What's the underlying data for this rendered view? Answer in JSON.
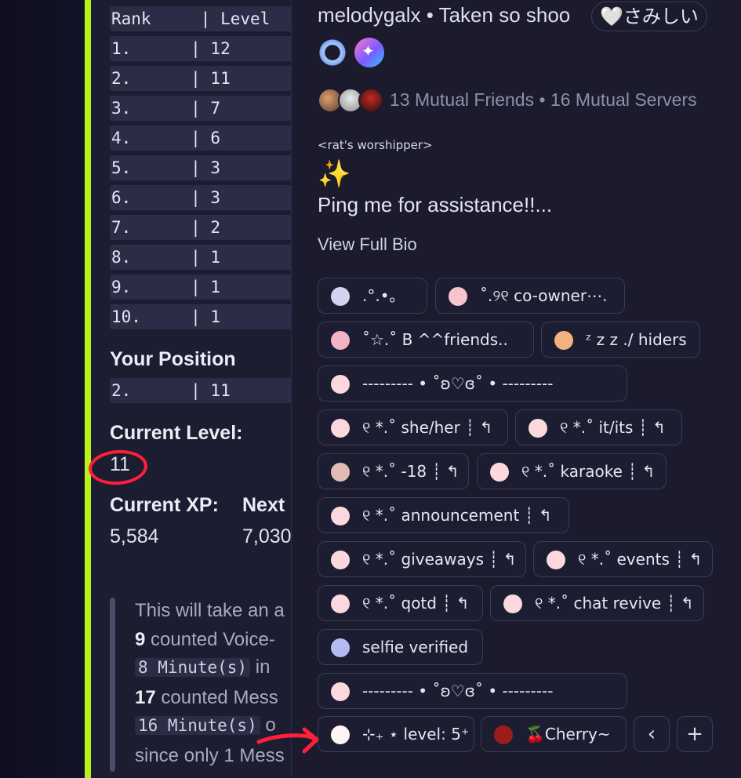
{
  "leaderboard": {
    "header": "Rank     | Level",
    "rows": [
      "1.      | 12",
      "2.      | 11",
      "3.      | 7",
      "4.      | 6",
      "5.      | 3",
      "6.      | 3",
      "7.      | 2",
      "8.      | 1",
      "9.      | 1",
      "10.     | 1"
    ],
    "your_position_title": "Your Position",
    "your_position_row": "2.      | 11",
    "current_level_title": "Current Level:",
    "current_level_value": "11",
    "current_xp_title": "Current XP:",
    "current_xp_value": "5,584",
    "next_title": "Next",
    "next_value": "7,030"
  },
  "quote": {
    "line1": "This will take an a",
    "line2_bold": "9",
    "line2_rest": " counted Voice-",
    "line3_code": "8 Minute(s)",
    "line3_rest": " in",
    "line4_bold": "17",
    "line4_rest": " counted Mess",
    "line5_code": "16 Minute(s)",
    "line5_rest": " o",
    "line6": "since only 1 Mess"
  },
  "profile": {
    "username_line": "melodygalx • Taken so shoo",
    "status_text": "🤍さみしい",
    "mutual_friends": "13 Mutual Friends",
    "mutual_sep": "•",
    "mutual_servers": "16 Mutual Servers",
    "bio_tag": "<rat's worshipper>",
    "bio_sparkle": "✨",
    "bio_line": "Ping me for assistance!!...",
    "view_full_bio": "View Full Bio",
    "roles": [
      {
        "label": ".°.•｡",
        "color": "#d5d2f0"
      },
      {
        "label": "˚.୨୧ co-owner⋯.",
        "color": "#f7c3cf"
      },
      {
        "label": "˚☆.˚ B ^^friends..",
        "color": "#f2b4c2"
      },
      {
        "label": "ᶻ z 𝗓 ./ hiders",
        "color": "#f1b27e"
      },
      {
        "label": "--------- • ˚ʚ♡ɞ˚ • ---------",
        "color": "#fbd8de"
      },
      {
        "label": "୧ *.˚ she/her ┊ ↰",
        "color": "#fbd8de"
      },
      {
        "label": "୧ *.˚ it/its ┊ ↰",
        "color": "#fbd8de"
      },
      {
        "label": "୧ *.˚ -18 ┊ ↰",
        "color": "#e2bcb4"
      },
      {
        "label": "୧ *.˚ karaoke ┊ ↰",
        "color": "#fbd8de"
      },
      {
        "label": "୧ *.˚ announcement ┊ ↰",
        "color": "#fbd8de"
      },
      {
        "label": "୧ *.˚ giveaways ┊ ↰",
        "color": "#fbd8de"
      },
      {
        "label": "୧ *.˚ events ┊ ↰",
        "color": "#fbd8de"
      },
      {
        "label": "୧ *.˚ qotd ┊ ↰",
        "color": "#fbd8de"
      },
      {
        "label": "୧ *.˚ chat revive ┊ ↰",
        "color": "#fbd8de"
      },
      {
        "label": "selfie verified",
        "color": "#b3bcf2"
      },
      {
        "label": "--------- • ˚ʚ♡ɞ˚ • ---------",
        "color": "#fbd8de"
      },
      {
        "label": "⊹₊ ⋆ level: 5⁺",
        "color": "#fff4f4"
      },
      {
        "label": "🍒Cherry~",
        "color": "#9c1c1c"
      }
    ],
    "collapse_icon": "‹",
    "add_role_icon": "+"
  },
  "colors": {
    "accent": "#b8f21a",
    "annotation": "#ff1f3d"
  }
}
